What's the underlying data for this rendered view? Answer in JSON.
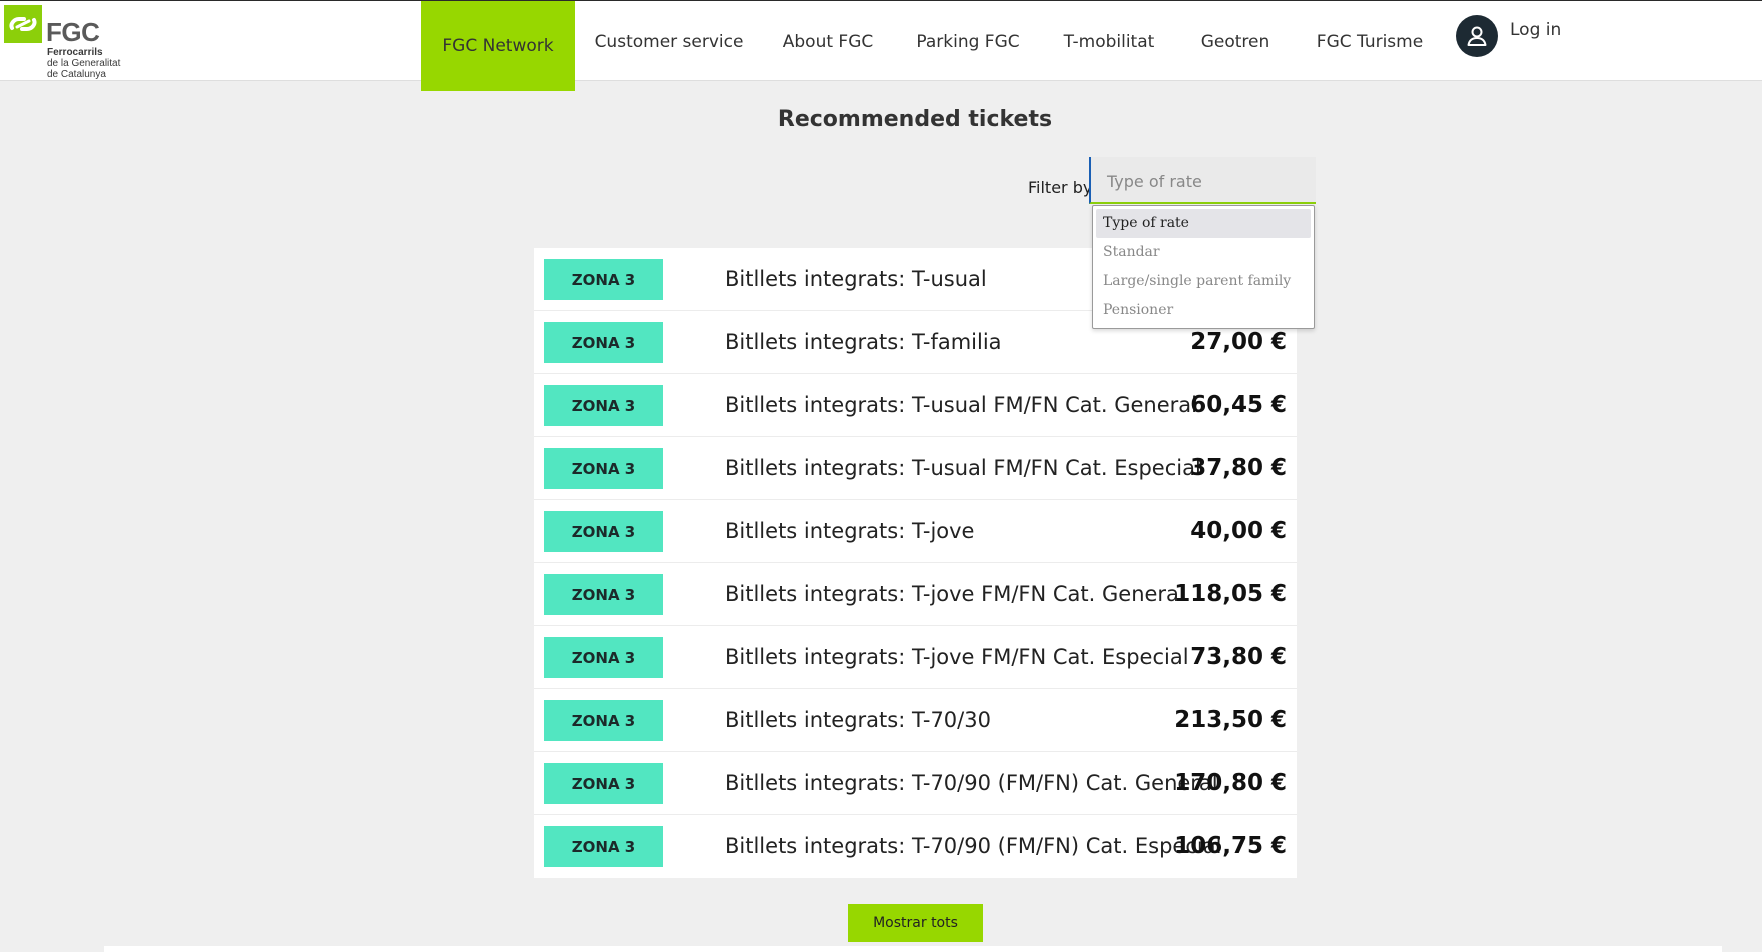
{
  "header": {
    "logo": {
      "brand": "FGC",
      "line1": "Ferrocarrils",
      "line2": "de la Generalitat",
      "line3": "de Catalunya"
    },
    "nav": [
      {
        "label": "FGC Network",
        "active": true
      },
      {
        "label": "Customer service",
        "active": false
      },
      {
        "label": "About FGC",
        "active": false
      },
      {
        "label": "Parking FGC",
        "active": false
      },
      {
        "label": "T-mobilitat",
        "active": false
      },
      {
        "label": "Geotren",
        "active": false
      },
      {
        "label": "FGC Turisme",
        "active": false
      }
    ],
    "login_label": "Log in"
  },
  "main": {
    "title": "Recommended tickets",
    "filter": {
      "label": "Filter by:",
      "placeholder": "Type of rate",
      "options": [
        "Type of rate",
        "Standar",
        "Large/single parent family",
        "Pensioner"
      ],
      "highlighted_option": "Type of rate"
    },
    "tickets": [
      {
        "zone": "ZONA 3",
        "name": "Bitllets integrats: T-usual",
        "price": ""
      },
      {
        "zone": "ZONA 3",
        "name": "Bitllets integrats: T-familia",
        "price": "27,00 €"
      },
      {
        "zone": "ZONA 3",
        "name": "Bitllets integrats: T-usual FM/FN Cat. General",
        "price": "60,45 €"
      },
      {
        "zone": "ZONA 3",
        "name": "Bitllets integrats: T-usual FM/FN Cat. Especial",
        "price": "37,80 €"
      },
      {
        "zone": "ZONA 3",
        "name": "Bitllets integrats: T-jove",
        "price": "40,00 €"
      },
      {
        "zone": "ZONA 3",
        "name": "Bitllets integrats: T-jove FM/FN Cat. General",
        "price": "118,05 €"
      },
      {
        "zone": "ZONA 3",
        "name": "Bitllets integrats: T-jove FM/FN Cat. Especial",
        "price": "73,80 €"
      },
      {
        "zone": "ZONA 3",
        "name": "Bitllets integrats: T-70/30",
        "price": "213,50 €"
      },
      {
        "zone": "ZONA 3",
        "name": "Bitllets integrats: T-70/90 (FM/FN) Cat. General",
        "price": "170,80 €"
      },
      {
        "zone": "ZONA 3",
        "name": "Bitllets integrats: T-70/90 (FM/FN) Cat. Especial",
        "price": "106,75 €"
      }
    ],
    "show_all_label": "Mostrar tots"
  },
  "colors": {
    "accent_green": "#97d700",
    "zone_badge": "#52e6c1",
    "background": "#efefef"
  }
}
